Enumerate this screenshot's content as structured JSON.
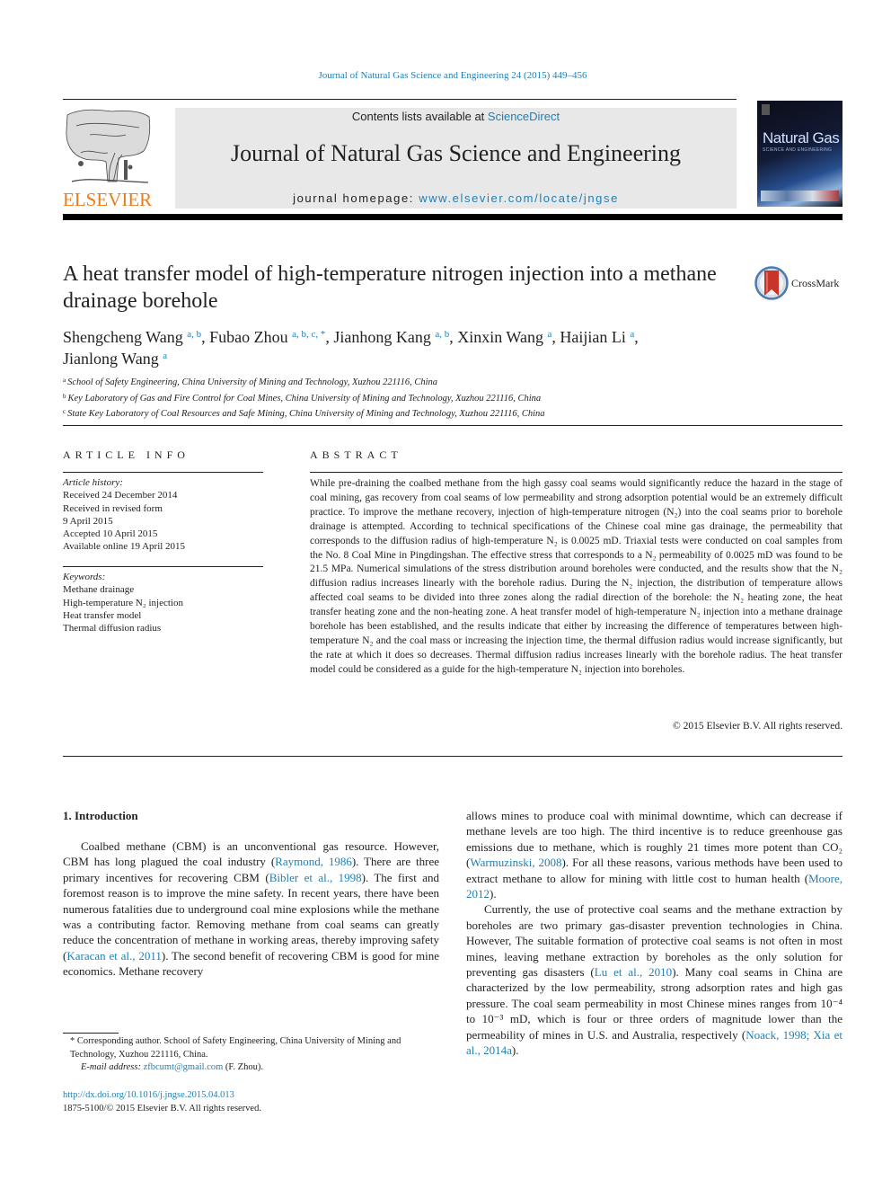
{
  "header": {
    "journal_reference": "Journal of Natural Gas Science and Engineering 24 (2015) 449–456",
    "contents_prefix": "Contents lists available at ",
    "contents_link": "ScienceDirect",
    "journal_title": "Journal of Natural Gas Science and Engineering",
    "homepage_prefix": "journal homepage: ",
    "homepage_link": "www.elsevier.com/locate/jngse",
    "publisher_logo_text": "ELSEVIER",
    "cover": {
      "title": "Natural Gas",
      "subtitle": "SCIENCE AND ENGINEERING"
    },
    "colors": {
      "link": "#1f7fb5",
      "elsevier_orange": "#e87d1e",
      "masthead_bg": "#e8e8e8"
    }
  },
  "article": {
    "title": "A heat transfer model of high-temperature nitrogen injection into a methane drainage borehole",
    "crossmark_label": "CrossMark",
    "authors": [
      {
        "name": "Shengcheng Wang",
        "affil": "a, b",
        "sep": ", "
      },
      {
        "name": "Fubao Zhou",
        "affil": "a, b, c, *",
        "sep": ", "
      },
      {
        "name": "Jianhong Kang",
        "affil": "a, b",
        "sep": ", "
      },
      {
        "name": "Xinxin Wang",
        "affil": "a",
        "sep": ", "
      },
      {
        "name": "Haijian Li",
        "affil": "a",
        "sep": ","
      },
      {
        "name": "Jianlong Wang",
        "affil": "a",
        "sep": ""
      }
    ],
    "affiliations": [
      {
        "mark": "a",
        "text": "School of Safety Engineering, China University of Mining and Technology, Xuzhou 221116, China"
      },
      {
        "mark": "b",
        "text": "Key Laboratory of Gas and Fire Control for Coal Mines, China University of Mining and Technology, Xuzhou 221116, China"
      },
      {
        "mark": "c",
        "text": "State Key Laboratory of Coal Resources and Safe Mining, China University of Mining and Technology, Xuzhou 221116, China"
      }
    ]
  },
  "article_info": {
    "heading": "ARTICLE INFO",
    "history_label": "Article history:",
    "history": [
      "Received 24 December 2014",
      "Received in revised form",
      "9 April 2015",
      "Accepted 10 April 2015",
      "Available online 19 April 2015"
    ],
    "keywords_label": "Keywords:",
    "keywords": [
      "Methane drainage",
      "High-temperature N₂ injection",
      "Heat transfer model",
      "Thermal diffusion radius"
    ]
  },
  "abstract": {
    "heading": "ABSTRACT",
    "text": "While pre-draining the coalbed methane from the high gassy coal seams would significantly reduce the hazard in the stage of coal mining, gas recovery from coal seams of low permeability and strong adsorption potential would be an extremely difficult practice. To improve the methane recovery, injection of high-temperature nitrogen (N₂) into the coal seams prior to borehole drainage is attempted. According to technical specifications of the Chinese coal mine gas drainage, the permeability that corresponds to the diffusion radius of high-temperature N₂ is 0.0025 mD. Triaxial tests were conducted on coal samples from the No. 8 Coal Mine in Pingdingshan. The effective stress that corresponds to a N₂ permeability of 0.0025 mD was found to be 21.5 MPa. Numerical simulations of the stress distribution around boreholes were conducted, and the results show that the N₂ diffusion radius increases linearly with the borehole radius. During the N₂ injection, the distribution of temperature allows affected coal seams to be divided into three zones along the radial direction of the borehole: the N₂ heating zone, the heat transfer heating zone and the non-heating zone. A heat transfer model of high-temperature N₂ injection into a methane drainage borehole has been established, and the results indicate that either by increasing the difference of temperatures between high-temperature N₂ and the coal mass or increasing the injection time, the thermal diffusion radius would increase significantly, but the rate at which it does so decreases. Thermal diffusion radius increases linearly with the borehole radius. The heat transfer model could be considered as a guide for the high-temperature N₂ injection into boreholes.",
    "copyright": "© 2015 Elsevier B.V. All rights reserved."
  },
  "introduction": {
    "heading": "1.  Introduction",
    "col1_p1": [
      {
        "t": "Coalbed methane (CBM) is an unconventional gas resource. However, CBM has long plagued the coal industry ("
      },
      {
        "t": "Raymond, 1986",
        "link": true
      },
      {
        "t": "). There are three primary incentives for recovering CBM ("
      },
      {
        "t": "Bibler et al., 1998",
        "link": true
      },
      {
        "t": "). The first and foremost reason is to improve the mine safety. In recent years, there have been numerous fatalities due to underground coal mine explosions while the methane was a contributing factor. Removing methane from coal seams can greatly reduce the concentration of methane in working areas, thereby improving safety ("
      },
      {
        "t": "Karacan et al., 2011",
        "link": true
      },
      {
        "t": "). The second benefit of recovering CBM is good for mine economics. Methane recovery"
      }
    ],
    "col2_p1": [
      {
        "t": "allows mines to produce coal with minimal downtime, which can decrease if methane levels are too high. The third incentive is to reduce greenhouse gas emissions due to methane, which is roughly 21 times more potent than CO₂ ("
      },
      {
        "t": "Warmuzinski, 2008",
        "link": true
      },
      {
        "t": "). For all these reasons, various methods have been used to extract methane to allow for mining with little cost to human health ("
      },
      {
        "t": "Moore, 2012",
        "link": true
      },
      {
        "t": ")."
      }
    ],
    "col2_p2": [
      {
        "t": "Currently, the use of protective coal seams and the methane extraction by boreholes are two primary gas-disaster prevention technologies in China. However, The suitable formation of protective coal seams is not often in most mines, leaving methane extraction by boreholes as the only solution for preventing gas disasters ("
      },
      {
        "t": "Lu et al., 2010",
        "link": true
      },
      {
        "t": "). Many coal seams in China are characterized by the low permeability, strong adsorption rates and high gas pressure. The coal seam permeability in most Chinese mines ranges from 10⁻⁴ to 10⁻³ mD, which is four or three orders of magnitude lower than the permeability of mines in U.S. and Australia, respectively ("
      },
      {
        "t": "Noack, 1998; Xia et al., 2014a",
        "link": true
      },
      {
        "t": ")."
      }
    ]
  },
  "footnote": {
    "star_text": "* Corresponding author. School of Safety Engineering, China University of Mining and Technology, Xuzhou 221116, China.",
    "email_label": "E-mail address: ",
    "email": "zfbcumt@gmail.com",
    "email_suffix": " (F. Zhou)."
  },
  "doi": "http://dx.doi.org/10.1016/j.jngse.2015.04.013",
  "issn": "1875-5100/© 2015 Elsevier B.V. All rights reserved."
}
